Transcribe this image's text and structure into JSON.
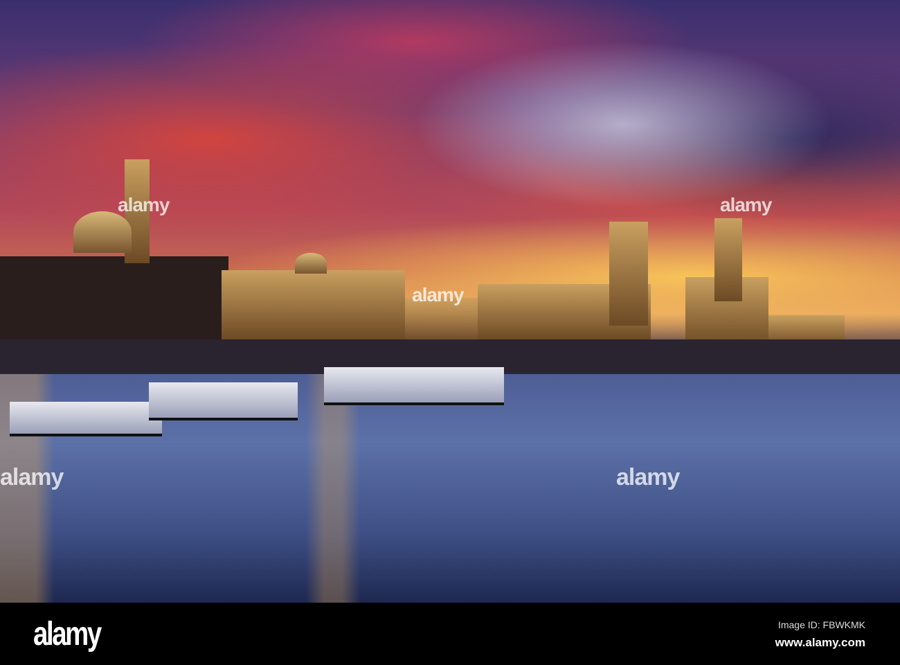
{
  "watermark": {
    "text": "alamy"
  },
  "footer": {
    "logo": "alamy",
    "image_id": "Image ID: FBWKMK",
    "website": "www.alamy.com"
  }
}
